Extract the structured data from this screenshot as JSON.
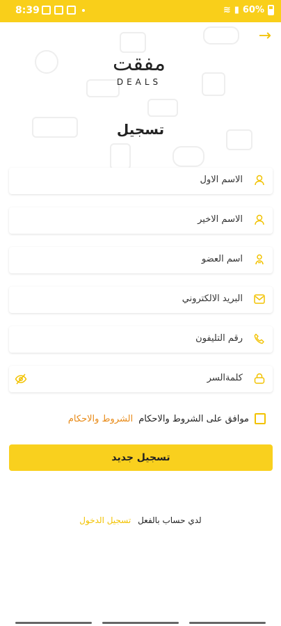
{
  "status_bar": {
    "time": "8:39",
    "battery": "60%"
  },
  "header": {
    "back_icon": "arrow-right-icon"
  },
  "logo": {
    "arabic": "مفقت",
    "english": "DEALS"
  },
  "title": "تسجيل",
  "fields": [
    {
      "label": "الاسم الاول",
      "icon": "person-icon"
    },
    {
      "label": "الاسم الاخير",
      "icon": "person-icon"
    },
    {
      "label": "اسم العضو",
      "icon": "member-icon"
    },
    {
      "label": "البريد الالكتروني",
      "icon": "email-icon"
    },
    {
      "label": "رقم التليفون",
      "icon": "phone-icon"
    },
    {
      "label": "كلمةالسر",
      "icon": "lock-icon",
      "toggle_icon": "eye-off-icon"
    }
  ],
  "terms": {
    "text": "موافق على الشروط والاحكام",
    "link": "الشروط والاحكام"
  },
  "submit_label": "تسجيل جديد",
  "login": {
    "prompt": "لدي حساب بالفعل",
    "link": "تسجيل الدخول"
  },
  "colors": {
    "accent": "#F9CF1A",
    "link": "#E88A17"
  }
}
